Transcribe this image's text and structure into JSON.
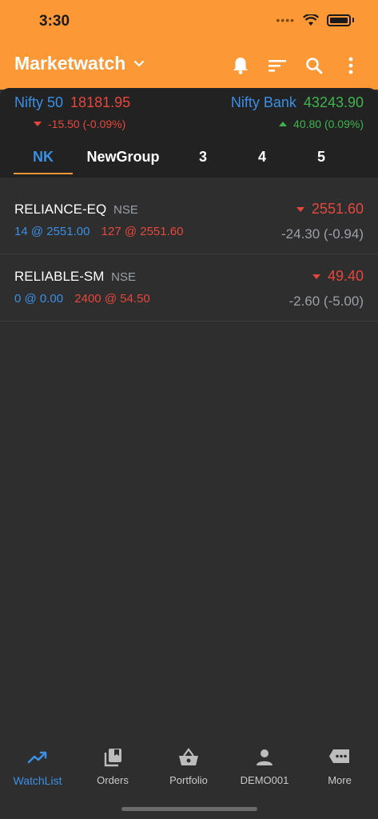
{
  "status_bar": {
    "time": "3:30"
  },
  "header": {
    "title": "Marketwatch"
  },
  "indices": [
    {
      "name": "Nifty 50",
      "value": "18181.95",
      "change": "-15.50 (-0.09%)",
      "direction": "down"
    },
    {
      "name": "Nifty Bank",
      "value": "43243.90",
      "change": "40.80 (0.09%)",
      "direction": "up"
    }
  ],
  "tabs": [
    {
      "label": "NK",
      "active": true
    },
    {
      "label": "NewGroup",
      "active": false
    },
    {
      "label": "3",
      "active": false
    },
    {
      "label": "4",
      "active": false
    },
    {
      "label": "5",
      "active": false
    }
  ],
  "watchlist": [
    {
      "symbol": "RELIANCE-EQ",
      "exchange": "NSE",
      "bid": "14 @ 2551.00",
      "ask": "127 @ 2551.60",
      "ltp": "2551.60",
      "change": "-24.30 (-0.94)",
      "direction": "down"
    },
    {
      "symbol": "RELIABLE-SM",
      "exchange": "NSE",
      "bid": "0 @ 0.00",
      "ask": "2400 @ 54.50",
      "ltp": "49.40",
      "change": "-2.60 (-5.00)",
      "direction": "down"
    }
  ],
  "bottom_nav": [
    {
      "label": "WatchList",
      "icon": "trending-up-icon",
      "active": true
    },
    {
      "label": "Orders",
      "icon": "orders-book-icon",
      "active": false
    },
    {
      "label": "Portfolio",
      "icon": "basket-icon",
      "active": false
    },
    {
      "label": "DEMO001",
      "icon": "person-icon",
      "active": false
    },
    {
      "label": "More",
      "icon": "more-chat-icon",
      "active": false
    }
  ],
  "colors": {
    "header": "#fd9836",
    "accent_blue": "#3a8fe5",
    "negative": "#e5473c",
    "positive": "#3fb34f",
    "background": "#2e2e2e"
  }
}
